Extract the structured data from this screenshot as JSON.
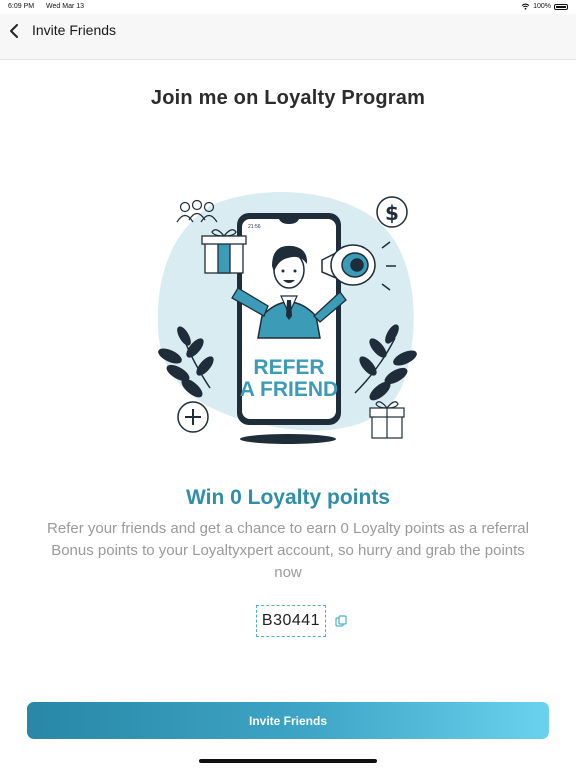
{
  "status": {
    "time": "6:09 PM",
    "date": "Wed Mar 13",
    "battery": "100%"
  },
  "nav": {
    "title": "Invite Friends",
    "back_icon": "chevron-left-icon"
  },
  "heading": "Join me on Loyalty Program",
  "illustration": {
    "phone_time": "21:56",
    "line1": "REFER",
    "line2": "A FRIEND",
    "icons": [
      "people-icon",
      "dollar-icon",
      "plus-icon",
      "gift-icon",
      "megaphone-icon"
    ]
  },
  "win_title": "Win 0 Loyalty points",
  "description": "Refer your friends and get a chance to earn 0 Loyalty points as a referral Bonus points to your Loyaltyxpert account, so hurry and grab the points now",
  "referral_code": "B30441",
  "cta_label": "Invite Friends",
  "colors": {
    "accent": "#2f8eaa",
    "gradient_start": "#2887a6",
    "gradient_end": "#6ad1ee",
    "nav_bg": "#f7f7f7"
  }
}
